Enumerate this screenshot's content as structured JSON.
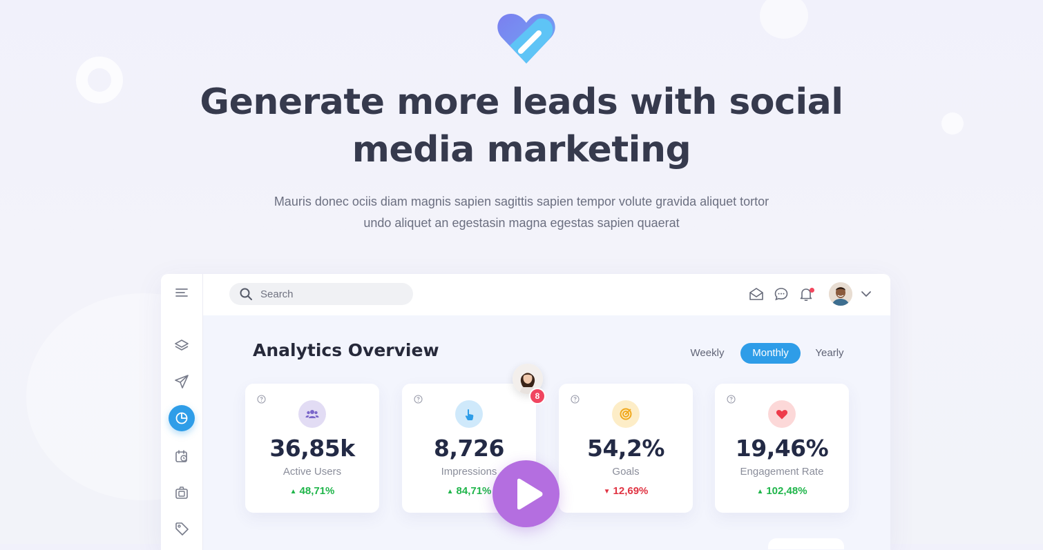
{
  "hero": {
    "headline_line1": "Generate more leads with social",
    "headline_line2": "media marketing",
    "subtitle_line1": "Mauris donec ociis diam magnis sapien sagittis sapien tempor volute gravida aliquet tortor",
    "subtitle_line2": "undo aliquet an egestasin magna egestas sapien quaerat"
  },
  "colors": {
    "accent_blue": "#2e9de8",
    "play_purple": "#b46ee0",
    "positive": "#1fb54a",
    "negative": "#e03342"
  },
  "dashboard": {
    "search": {
      "placeholder": "Search"
    },
    "sidebar": [
      {
        "icon": "menu-icon"
      },
      {
        "icon": "layers-icon"
      },
      {
        "icon": "send-icon"
      },
      {
        "icon": "pie-chart-icon",
        "active": true
      },
      {
        "icon": "calendar-clock-icon"
      },
      {
        "icon": "camera-icon"
      },
      {
        "icon": "tag-icon"
      }
    ],
    "topbar_icons": [
      "mail-icon",
      "chat-icon",
      "bell-icon"
    ],
    "title": "Analytics Overview",
    "periods": [
      {
        "label": "Weekly",
        "active": false
      },
      {
        "label": "Monthly",
        "active": true
      },
      {
        "label": "Yearly",
        "active": false
      }
    ],
    "cards": [
      {
        "value": "36,85k",
        "label": "Active Users",
        "change": "48,71%",
        "trend": "up",
        "icon": "users-icon"
      },
      {
        "value": "8,726",
        "label": "Impressions",
        "change": "84,71%",
        "trend": "up",
        "icon": "tap-icon"
      },
      {
        "value": "54,2%",
        "label": "Goals",
        "change": "12,69%",
        "trend": "down",
        "icon": "target-icon"
      },
      {
        "value": "19,46%",
        "label": "Engagement Rate",
        "change": "102,48%",
        "trend": "up",
        "icon": "heart-icon"
      }
    ],
    "notification_badge": "8"
  }
}
